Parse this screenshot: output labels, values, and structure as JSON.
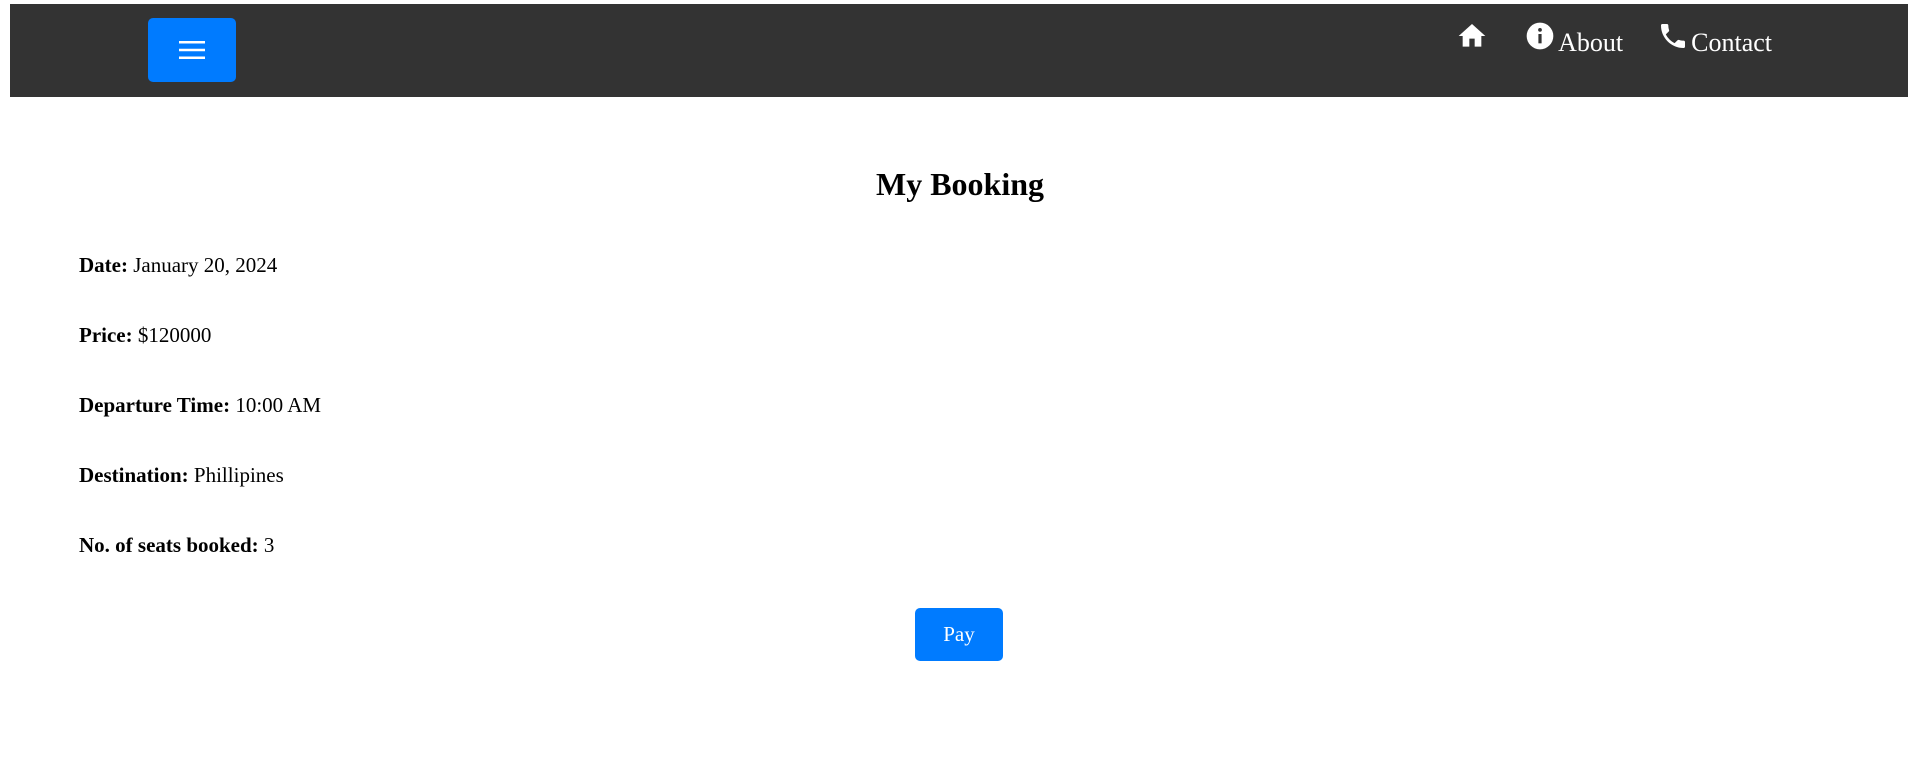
{
  "colors": {
    "topbar_background": "#333333",
    "accent": "#007bff",
    "text": "#000000",
    "nav_text": "#ffffff"
  },
  "header": {
    "menu_icon": "hamburger-menu-icon",
    "nav": [
      {
        "icon": "home-icon",
        "label": ""
      },
      {
        "icon": "info-icon",
        "label": "About"
      },
      {
        "icon": "phone-icon",
        "label": "Contact"
      }
    ]
  },
  "booking": {
    "title": "My Booking",
    "fields": [
      {
        "label": "Date:",
        "value": "January 20, 2024"
      },
      {
        "label": "Price:",
        "value": "$120000"
      },
      {
        "label": "Departure Time:",
        "value": "10:00 AM"
      },
      {
        "label": "Destination:",
        "value": "Phillipines"
      },
      {
        "label": "No. of seats booked:",
        "value": "3"
      }
    ],
    "pay_label": "Pay"
  }
}
